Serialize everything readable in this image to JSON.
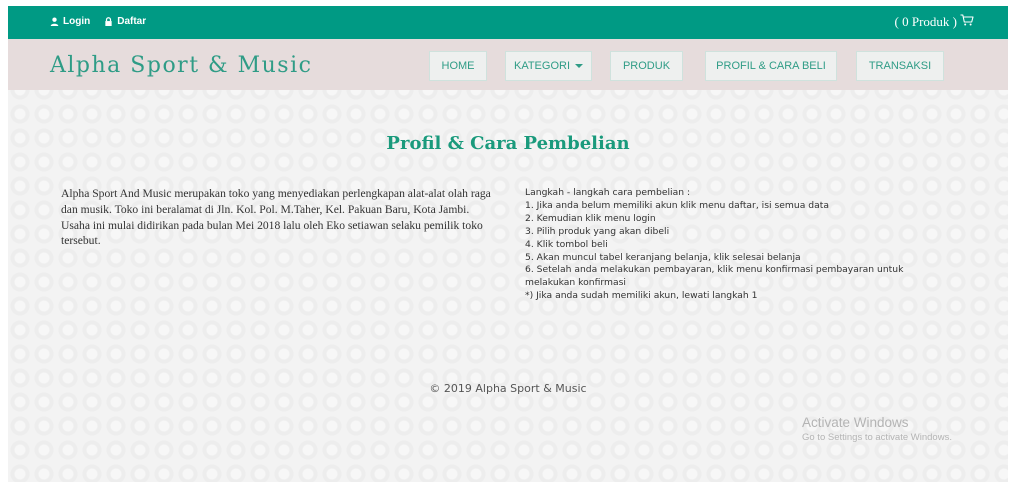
{
  "topbar": {
    "login_label": "Login",
    "daftar_label": "Daftar",
    "cart_label": "( 0 Produk )",
    "icons": [
      "user-icon",
      "lock-icon",
      "cart-icon"
    ],
    "background_color": "#009a84"
  },
  "header": {
    "brand": "Alpha Sport & Music",
    "background_color": "#e6dcdc",
    "nav": [
      {
        "label": "HOME"
      },
      {
        "label": "KATEGORI"
      },
      {
        "label": "PRODUK"
      },
      {
        "label": "PROFIL & CARA BELI"
      },
      {
        "label": "TRANSAKSI"
      }
    ]
  },
  "main": {
    "title": "Profil & Cara Pembelian",
    "profile_text": "Alpha Sport And Music merupakan toko yang menyediakan perlengkapan alat-alat olah raga dan musik. Toko ini beralamat di Jln. Kol. Pol. M.Taher, Kel. Pakuan Baru, Kota Jambi. Usaha ini mulai didirikan pada bulan Mei 2018 lalu oleh Eko setiawan selaku pemilik toko tersebut.",
    "steps_heading": "Langkah - langkah cara pembelian :",
    "steps": [
      "1. Jika anda belum memiliki akun klik menu daftar, isi semua data",
      "2. Kemudian klik menu login",
      "3. Pilih produk yang akan dibeli",
      "4. Klik tombol beli",
      "5. Akan muncul tabel keranjang belanja, klik selesai belanja",
      "6. Setelah anda melakukan pembayaran, klik menu konfirmasi pembayaran untuk",
      "melakukan konfirmasi",
      "*) Jika anda sudah memiliki akun, lewati langkah 1"
    ]
  },
  "footer": {
    "copyright": "© 2019 Alpha Sport & Music"
  },
  "watermark": {
    "title": "Activate Windows",
    "subtitle": "Go to Settings to activate Windows."
  }
}
